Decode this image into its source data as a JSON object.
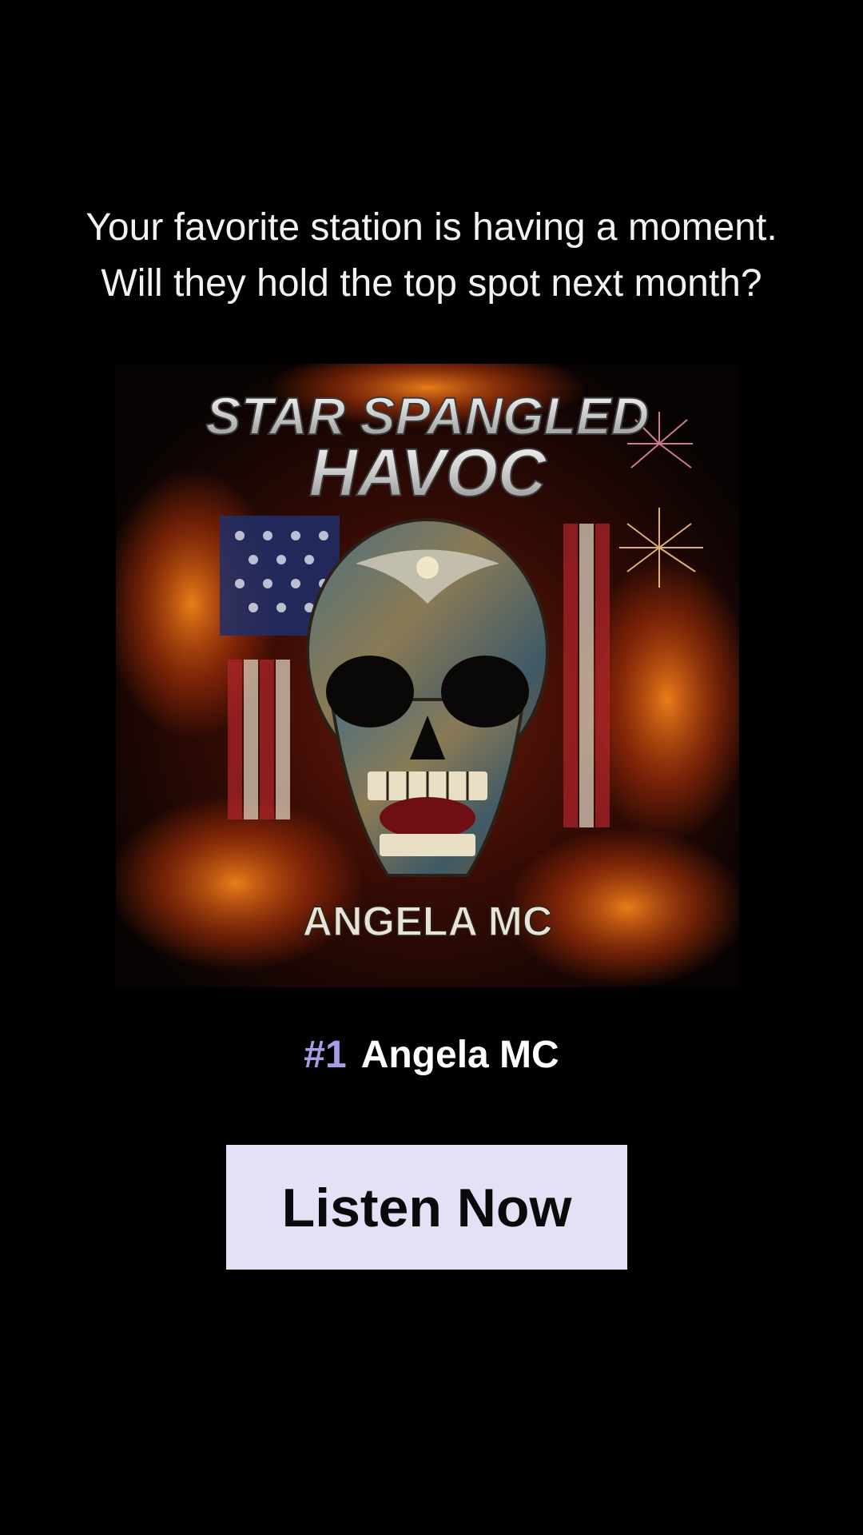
{
  "headline": {
    "line1": "Your favorite station is having a moment.",
    "line2": "Will they hold the top spot next month?"
  },
  "album": {
    "title_line1": "STAR SPANGLED",
    "title_line2": "HAVOC",
    "artist_on_cover": "ANGELA MC"
  },
  "ranking": {
    "rank": "#1",
    "artist": "Angela MC"
  },
  "cta": {
    "label": "Listen Now"
  },
  "colors": {
    "background": "#000000",
    "rank_accent": "#a99be6",
    "button_bg": "#e4e1f6",
    "button_text": "#0a0a0a"
  }
}
